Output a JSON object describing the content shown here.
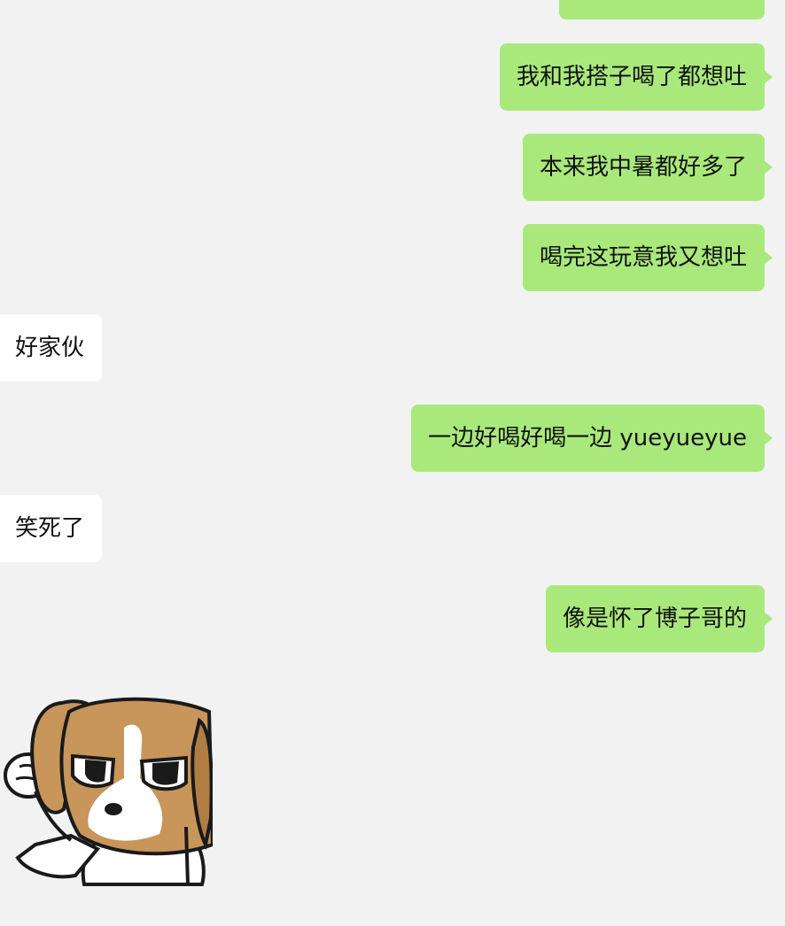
{
  "colors": {
    "background": "#f2f2f2",
    "outgoing_bubble": "#a9e97b",
    "incoming_bubble": "#ffffff",
    "text": "#111111"
  },
  "messages": [
    {
      "side": "out",
      "text": "我和我搭子喝了都想吐"
    },
    {
      "side": "out",
      "text": "本来我中暑都好多了"
    },
    {
      "side": "out",
      "text": "喝完这玩意我又想吐"
    },
    {
      "side": "in",
      "text": "好家伙"
    },
    {
      "side": "out",
      "text": "一边好喝好喝一边 yueyueyue"
    },
    {
      "side": "in",
      "text": "笑死了"
    },
    {
      "side": "out",
      "text": "像是怀了博子哥的"
    }
  ],
  "sticker": {
    "icon": "beagle-dog-fist-sticker",
    "side": "in"
  }
}
